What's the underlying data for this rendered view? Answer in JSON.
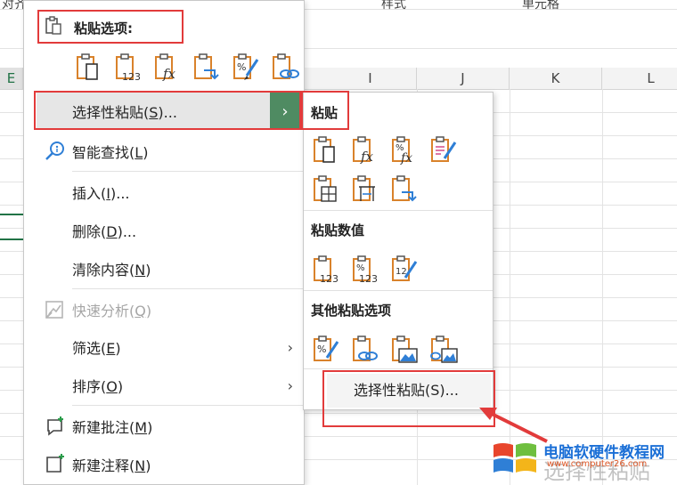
{
  "sheet": {
    "ribbon_labels": [
      "对齐",
      "样式",
      "单元格"
    ],
    "columns": [
      "E",
      "I",
      "J",
      "K",
      "L"
    ]
  },
  "menu": {
    "paste_options_title": "粘贴选项:",
    "items": [
      {
        "label": "选择性粘贴",
        "shortcut": "S",
        "suffix": "...",
        "icon": "blank"
      },
      {
        "label": "智能查找",
        "shortcut": "L",
        "suffix": "",
        "icon": "search-icon"
      },
      {
        "label": "插入",
        "shortcut": "I",
        "suffix": "...",
        "icon": "blank"
      },
      {
        "label": "删除",
        "shortcut": "D",
        "suffix": "...",
        "icon": "blank"
      },
      {
        "label": "清除内容",
        "shortcut": "N",
        "suffix": "",
        "icon": "blank"
      },
      {
        "label": "快速分析",
        "shortcut": "Q",
        "suffix": "",
        "icon": "quick-analysis-icon"
      },
      {
        "label": "筛选",
        "shortcut": "E",
        "suffix": "",
        "icon": "blank"
      },
      {
        "label": "排序",
        "shortcut": "O",
        "suffix": "",
        "icon": "blank"
      },
      {
        "label": "新建批注",
        "shortcut": "M",
        "suffix": "",
        "icon": "new-comment-icon"
      },
      {
        "label": "新建注释",
        "shortcut": "N",
        "suffix": "",
        "icon": "new-note-icon"
      }
    ]
  },
  "submenu": {
    "paste_title": "粘贴",
    "paste_values_title": "粘贴数值",
    "other_title": "其他粘贴选项",
    "button": "选择性粘贴(S)..."
  },
  "watermark": {
    "text": "电脑软硬件教程网",
    "url": "www.computer26.com",
    "big": "选择性粘贴"
  },
  "colors": {
    "accent_green": "#4f8b62",
    "annotation_red": "#e23b3b",
    "icon_orange": "#d9822b",
    "icon_blue": "#2f7fd6"
  }
}
